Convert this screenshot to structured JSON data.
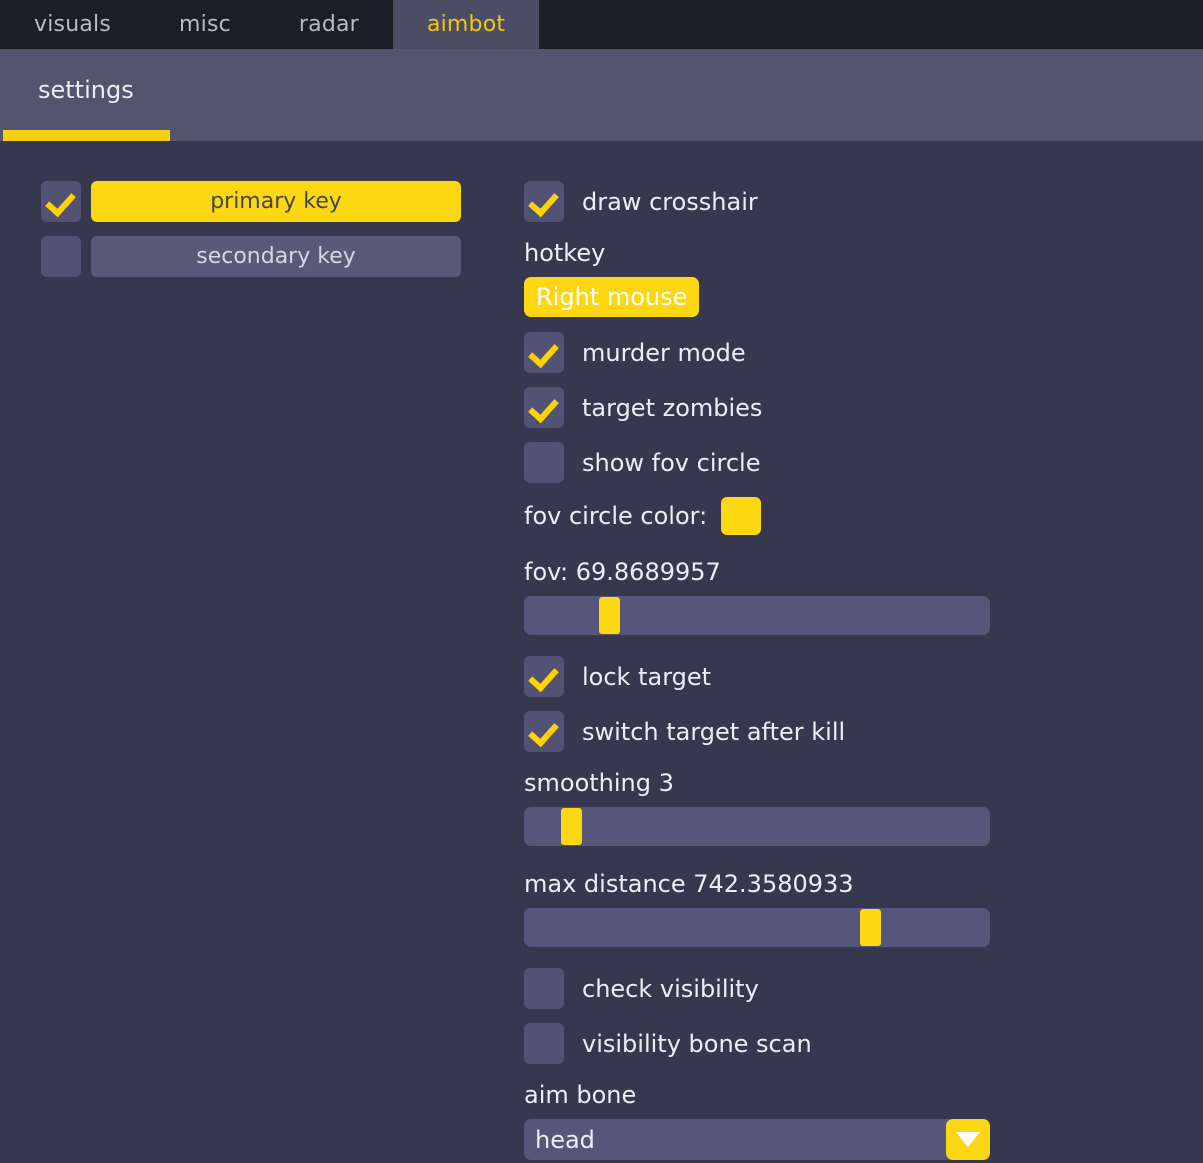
{
  "tabs": [
    {
      "label": "visuals",
      "active": false
    },
    {
      "label": "misc",
      "active": false
    },
    {
      "label": "radar",
      "active": false
    },
    {
      "label": "aimbot",
      "active": true
    }
  ],
  "subtab": {
    "label": "settings"
  },
  "left_panel": {
    "primary_key": {
      "checked": true,
      "label": "primary key"
    },
    "secondary_key": {
      "checked": false,
      "label": "secondary key"
    }
  },
  "right_panel": {
    "draw_crosshair": {
      "label": "draw crosshair",
      "checked": true
    },
    "hotkey_label": "hotkey",
    "hotkey_value": "Right mouse",
    "murder_mode": {
      "label": "murder mode",
      "checked": true
    },
    "target_zombies": {
      "label": "target zombies",
      "checked": true
    },
    "show_fov_circle": {
      "label": "show fov circle",
      "checked": false
    },
    "fov_circle_color_label": "fov circle color:",
    "fov_circle_color_value": "#FCD712",
    "fov": {
      "label": "fov: 69.8689957",
      "value": 69.8689957,
      "percent": 16
    },
    "lock_target": {
      "label": "lock target",
      "checked": true
    },
    "switch_target_after_kill": {
      "label": "switch target after kill",
      "checked": true
    },
    "smoothing": {
      "label": "smoothing 3",
      "value": 3,
      "percent": 8
    },
    "max_distance": {
      "label": "max distance 742.3580933",
      "value": 742.3580933,
      "percent": 72
    },
    "check_visibility": {
      "label": "check visibility",
      "checked": false
    },
    "visibility_bone_scan": {
      "label": "visibility bone scan",
      "checked": false
    },
    "aim_bone_label": "aim bone",
    "aim_bone_value": "head"
  },
  "colors": {
    "accent": "#FCD712",
    "background": "#373850",
    "tabbar": "#1D1D27",
    "subbar": "#53546E",
    "control": "#55567A"
  }
}
